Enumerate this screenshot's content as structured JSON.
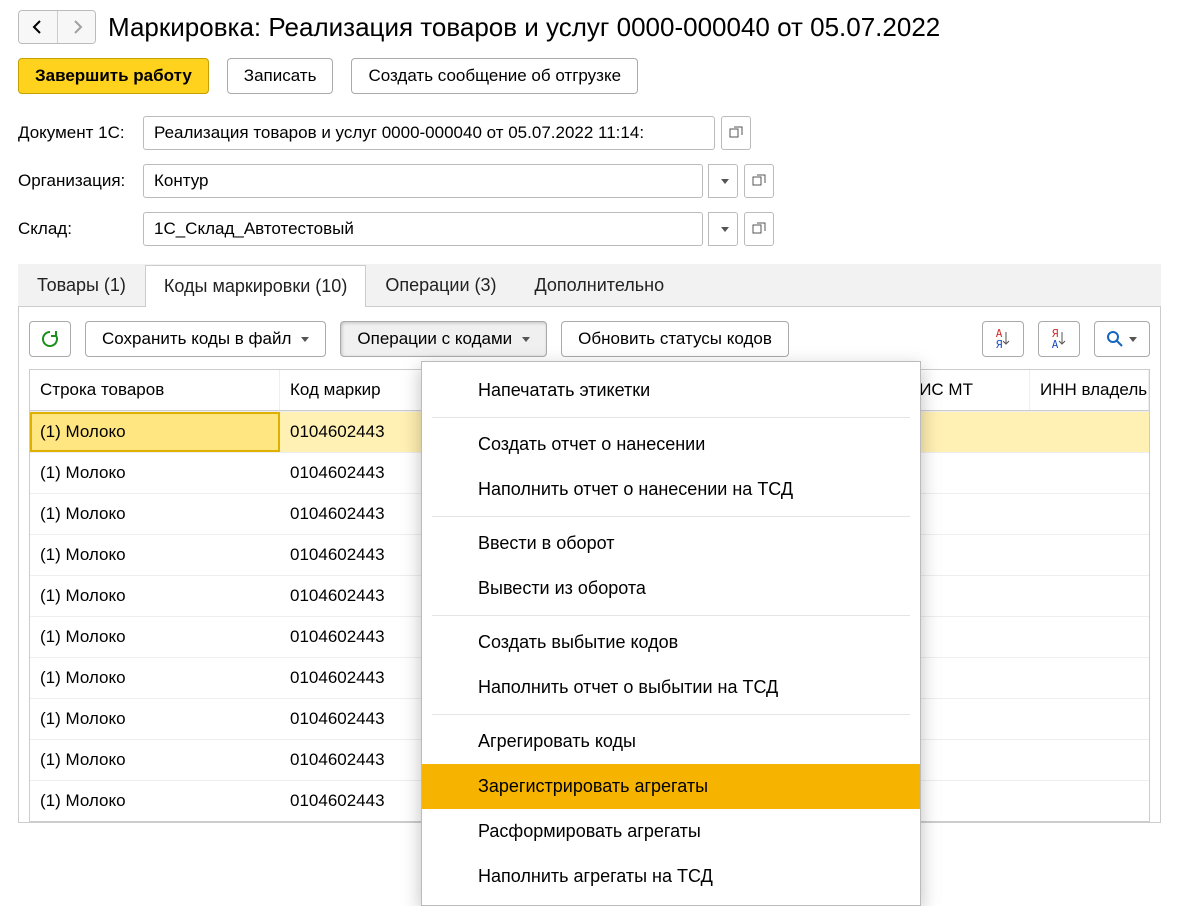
{
  "page_title": "Маркировка: Реализация товаров и услуг 0000-000040 от 05.07.2022",
  "top_buttons": {
    "finish": "Завершить работу",
    "save": "Записать",
    "create_msg": "Создать сообщение об отгрузке"
  },
  "form": {
    "doc_label": "Документ 1С:",
    "doc_value": "Реализация товаров и услуг 0000-000040 от 05.07.2022 11:14:",
    "org_label": "Организация:",
    "org_value": "Контур",
    "warehouse_label": "Склад:",
    "warehouse_value": "1С_Склад_Автотестовый"
  },
  "tabs": {
    "goods": "Товары (1)",
    "codes": "Коды маркировки (10)",
    "ops": "Операции (3)",
    "extra": "Дополнительно"
  },
  "toolbar2": {
    "save_codes": "Сохранить коды в файл",
    "code_ops": "Операции с кодами",
    "refresh_status": "Обновить статусы кодов"
  },
  "table": {
    "headers": {
      "row": "Строка товаров",
      "code": "Код маркир",
      "gis": "ГИС МТ",
      "inn": "ИНН владель"
    },
    "rows": [
      {
        "row": "(1) Молоко",
        "code": "0104602443"
      },
      {
        "row": "(1) Молоко",
        "code": "0104602443"
      },
      {
        "row": "(1) Молоко",
        "code": "0104602443"
      },
      {
        "row": "(1) Молоко",
        "code": "0104602443"
      },
      {
        "row": "(1) Молоко",
        "code": "0104602443"
      },
      {
        "row": "(1) Молоко",
        "code": "0104602443"
      },
      {
        "row": "(1) Молоко",
        "code": "0104602443"
      },
      {
        "row": "(1) Молоко",
        "code": "0104602443"
      },
      {
        "row": "(1) Молоко",
        "code": "0104602443"
      },
      {
        "row": "(1) Молоко",
        "code": "0104602443"
      }
    ]
  },
  "menu": {
    "items": [
      "Напечатать этикетки",
      "Создать отчет о нанесении",
      "Наполнить отчет о нанесении на ТСД",
      "Ввести в оборот",
      "Вывести из оборота",
      "Создать выбытие кодов",
      "Наполнить отчет о выбытии на ТСД",
      "Агрегировать коды",
      "Зарегистрировать агрегаты",
      "Расформировать агрегаты",
      "Наполнить агрегаты на ТСД"
    ],
    "separators_after": [
      0,
      2,
      4,
      6
    ]
  }
}
